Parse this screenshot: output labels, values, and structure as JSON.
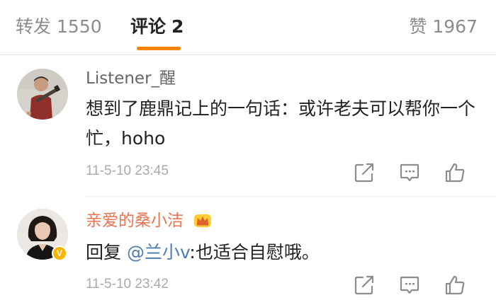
{
  "tabs": {
    "repost": {
      "label": "转发",
      "count": "1550"
    },
    "comment": {
      "label": "评论",
      "count": "2"
    },
    "like": {
      "label": "赞",
      "count": "1967"
    }
  },
  "comments": [
    {
      "username": "Listener_醒",
      "content": "想到了鹿鼎记上的一句话：或许老夫可以帮你一个忙，hoho",
      "timestamp": "11-5-10 23:45",
      "avatar": "avatar-man-with-guitar",
      "icons": [
        "share-icon",
        "reply-icon",
        "like-icon"
      ]
    },
    {
      "username": "亲爱的桑小洁",
      "content_prefix": "回复 ",
      "mention": "@兰小v",
      "content_suffix": ":也适合自慰哦。",
      "timestamp": "11-5-10 23:42",
      "avatar": "avatar-woman",
      "verified_badge": "V",
      "icons": [
        "share-icon",
        "reply-icon",
        "like-icon"
      ]
    }
  ],
  "colors": {
    "accent": "#ff8200",
    "vip_name": "#eb7350",
    "mention": "#507daf",
    "muted": "#8c8c8c"
  }
}
